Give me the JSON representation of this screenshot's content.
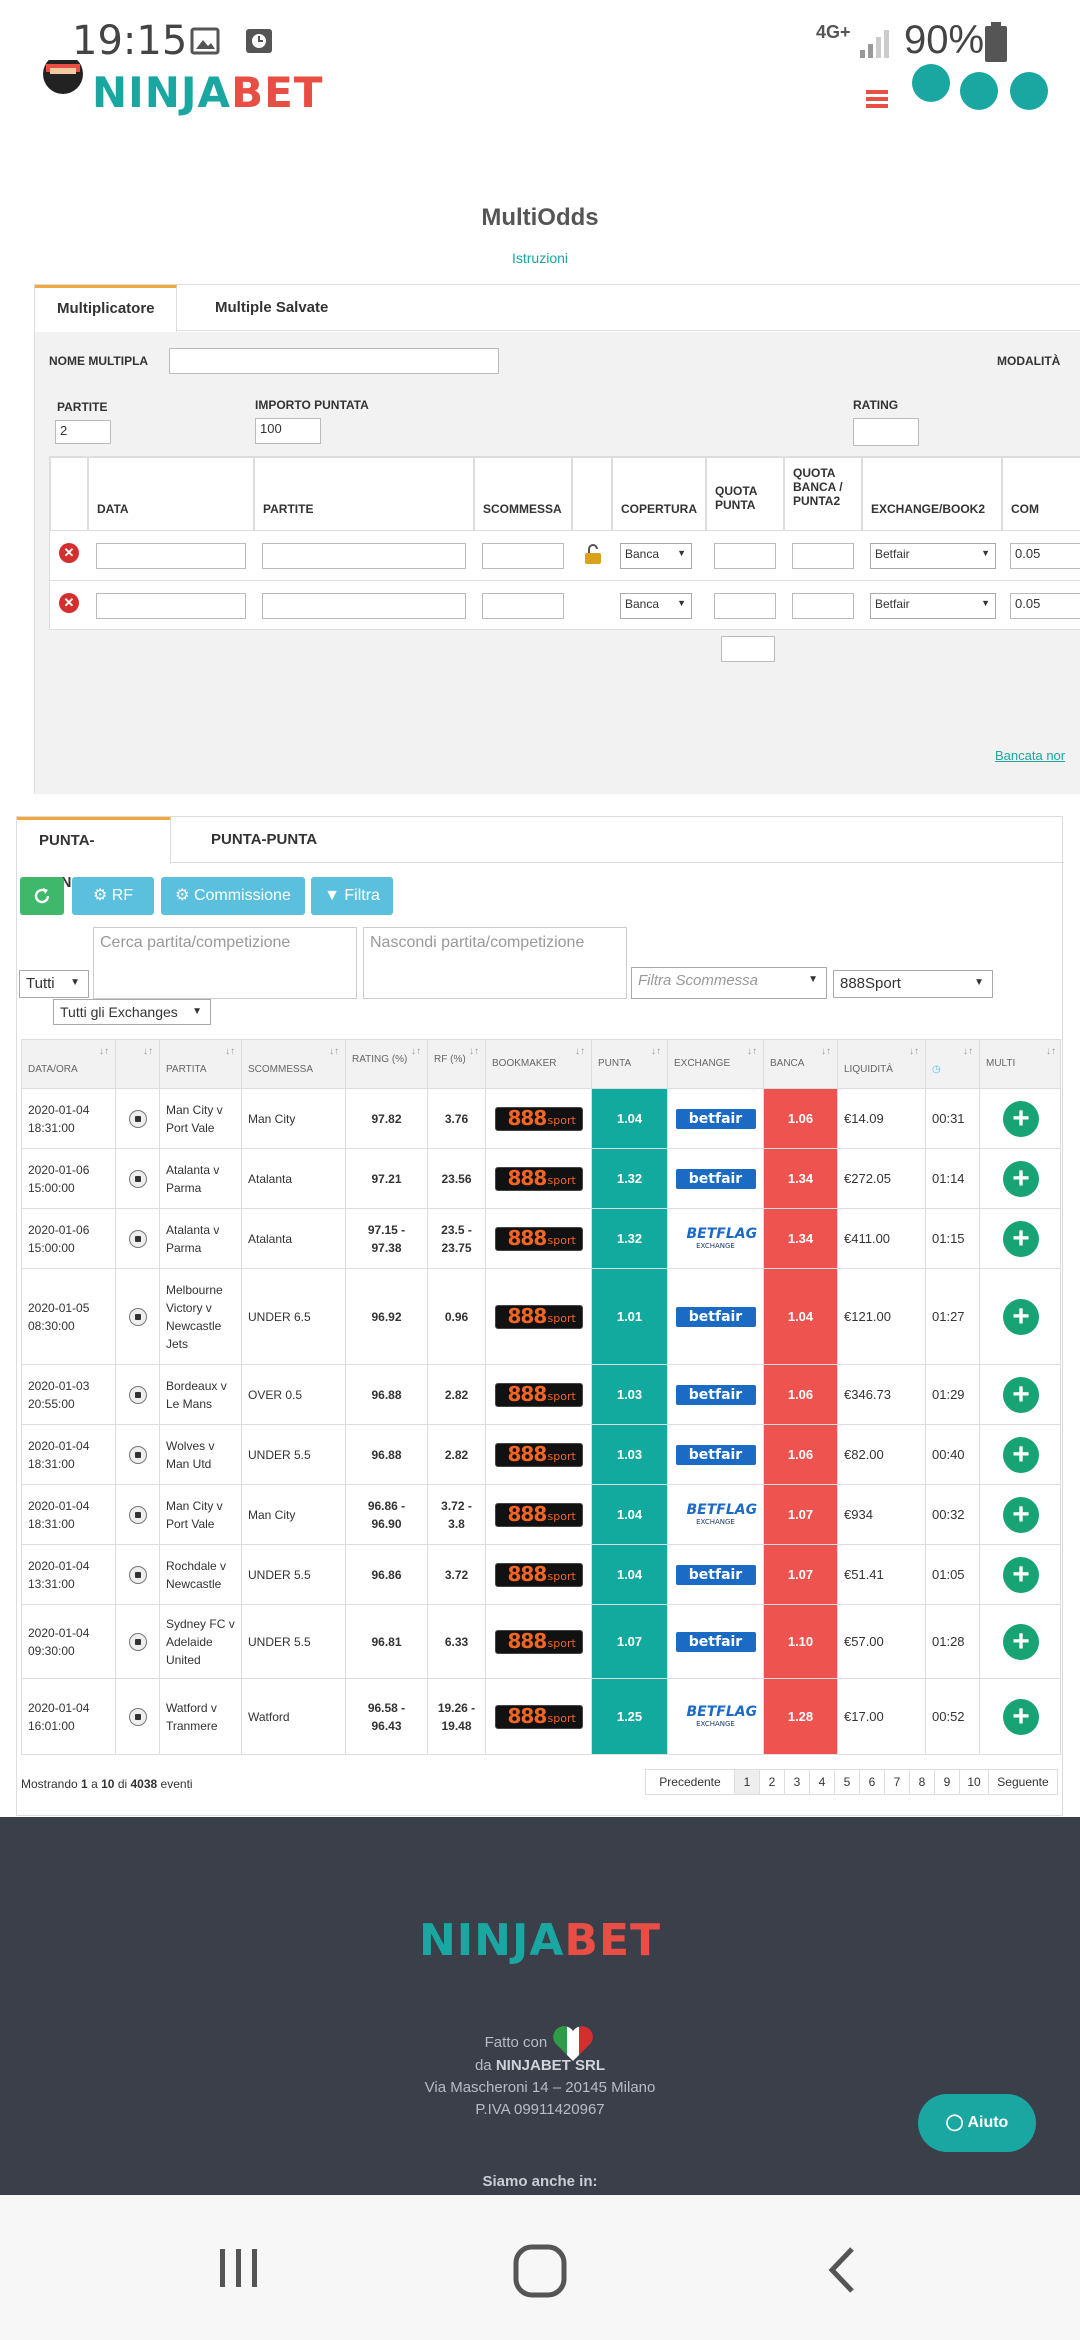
{
  "status": {
    "time": "19:15",
    "network": "4G+",
    "battery": "90%"
  },
  "header": {
    "logo_a": "NINJA",
    "logo_b": "BET"
  },
  "multiodds": {
    "title": "MultiOdds",
    "instructions_link": "Istruzioni",
    "tabs": [
      "Multiplicatore",
      "Multiple Salvate"
    ],
    "nome_multipla_label": "NOME MULTIPLA",
    "modalita_label": "MODALITÀ",
    "partite_label": "PARTITE",
    "partite_value": "2",
    "importo_label": "IMPORTO PUNTATA",
    "importo_value": "100",
    "rating_label": "RATING",
    "columns": [
      "DATA",
      "PARTITE",
      "SCOMMESSA",
      "COPERTURA",
      "QUOTA PUNTA",
      "QUOTA BANCA / PUNTA2",
      "EXCHANGE/BOOK2",
      "COM"
    ],
    "rows": [
      {
        "copertura": "Banca",
        "exchange": "Betfair",
        "com": "0.05"
      },
      {
        "copertura": "Banca",
        "exchange": "Betfair",
        "com": "0.05"
      }
    ],
    "bancata_link": "Bancata nor"
  },
  "odds": {
    "tabs": [
      "PUNTA-BANCA",
      "PUNTA-PUNTA"
    ],
    "buttons": {
      "rf": "RF",
      "commissione": "Commissione",
      "filtra": "Filtra"
    },
    "search_placeholder": "Cerca partita/competizione",
    "hide_placeholder": "Nascondi partita/competizione",
    "filter_bet_placeholder": "Filtra Scommessa",
    "select_all": "Tutti",
    "select_exchanges": "Tutti gli Exchanges",
    "select_bookmaker": "888Sport",
    "columns": [
      "DATA/ORA",
      "",
      "PARTITA",
      "SCOMMESSA",
      "RATING (%)",
      "RF (%)",
      "BOOKMAKER",
      "PUNTA",
      "EXCHANGE",
      "BANCA",
      "LIQUIDITÀ",
      "",
      "MULTI"
    ],
    "rows": [
      {
        "date": "2020-01-04",
        "time": "18:31:00",
        "match": "Man City v Port Vale",
        "bet": "Man City",
        "rating": "97.82",
        "rf": "3.76",
        "punta": "1.04",
        "exchange": "betfair",
        "banca": "1.06",
        "liq": "€14.09",
        "clock": "00:31"
      },
      {
        "date": "2020-01-06",
        "time": "15:00:00",
        "match": "Atalanta v Parma",
        "bet": "Atalanta",
        "rating": "97.21",
        "rf": "23.56",
        "punta": "1.32",
        "exchange": "betfair",
        "banca": "1.34",
        "liq": "€272.05",
        "clock": "01:14"
      },
      {
        "date": "2020-01-06",
        "time": "15:00:00",
        "match": "Atalanta v Parma",
        "bet": "Atalanta",
        "rating": "97.15 - 97.38",
        "rf": "23.5 - 23.75",
        "punta": "1.32",
        "exchange": "betflag",
        "banca": "1.34",
        "liq": "€411.00",
        "clock": "01:15"
      },
      {
        "date": "2020-01-05",
        "time": "08:30:00",
        "match": "Melbourne Victory v Newcastle Jets",
        "bet": "UNDER 6.5",
        "rating": "96.92",
        "rf": "0.96",
        "punta": "1.01",
        "exchange": "betfair",
        "banca": "1.04",
        "liq": "€121.00",
        "clock": "01:27"
      },
      {
        "date": "2020-01-03",
        "time": "20:55:00",
        "match": "Bordeaux v Le Mans",
        "bet": "OVER 0.5",
        "rating": "96.88",
        "rf": "2.82",
        "punta": "1.03",
        "exchange": "betfair",
        "banca": "1.06",
        "liq": "€346.73",
        "clock": "01:29"
      },
      {
        "date": "2020-01-04",
        "time": "18:31:00",
        "match": "Wolves v Man Utd",
        "bet": "UNDER 5.5",
        "rating": "96.88",
        "rf": "2.82",
        "punta": "1.03",
        "exchange": "betfair",
        "banca": "1.06",
        "liq": "€82.00",
        "clock": "00:40"
      },
      {
        "date": "2020-01-04",
        "time": "18:31:00",
        "match": "Man City v Port Vale",
        "bet": "Man City",
        "rating": "96.86 - 96.90",
        "rf": "3.72 - 3.8",
        "punta": "1.04",
        "exchange": "betflag",
        "banca": "1.07",
        "liq": "€934",
        "clock": "00:32"
      },
      {
        "date": "2020-01-04",
        "time": "13:31:00",
        "match": "Rochdale v Newcastle",
        "bet": "UNDER 5.5",
        "rating": "96.86",
        "rf": "3.72",
        "punta": "1.04",
        "exchange": "betfair",
        "banca": "1.07",
        "liq": "€51.41",
        "clock": "01:05"
      },
      {
        "date": "2020-01-04",
        "time": "09:30:00",
        "match": "Sydney FC v Adelaide United",
        "bet": "UNDER 5.5",
        "rating": "96.81",
        "rf": "6.33",
        "punta": "1.07",
        "exchange": "betfair",
        "banca": "1.10",
        "liq": "€57.00",
        "clock": "01:28"
      },
      {
        "date": "2020-01-04",
        "time": "16:01:00",
        "match": "Watford v Tranmere",
        "bet": "Watford",
        "rating": "96.58 - 96.43",
        "rf": "19.26 - 19.48",
        "punta": "1.25",
        "exchange": "betflag",
        "banca": "1.28",
        "liq": "€17.00",
        "clock": "00:52"
      }
    ],
    "bookmaker_a": "888",
    "bookmaker_b": "sport",
    "betfair_label": "betfair",
    "betflag_a": "BETFLAG",
    "betflag_b": "EXCHANGE",
    "info_prefix": "Mostrando",
    "info_from": "1",
    "info_mid": "a",
    "info_to": "10",
    "info_of": "di",
    "info_total": "4038",
    "info_suffix": "eventi",
    "pager": [
      "Precedente",
      "1",
      "2",
      "3",
      "4",
      "5",
      "6",
      "7",
      "8",
      "9",
      "10",
      "Seguente"
    ]
  },
  "footer": {
    "logo_a": "NINJA",
    "logo_b": "BET",
    "made_with": "Fatto con",
    "by_prefix": "da",
    "company": "NINJABET SRL",
    "address": "Via Mascheroni 14 – 20145 Milano",
    "piva": "P.IVA 09911420967",
    "also_in": "Siamo anche in:",
    "help": "Aiuto"
  },
  "colors": {
    "teal": "#1aa7a2",
    "red": "#e94e45",
    "punta": "#12a99e",
    "banca": "#ef5350",
    "footer": "#3b3f4a"
  }
}
